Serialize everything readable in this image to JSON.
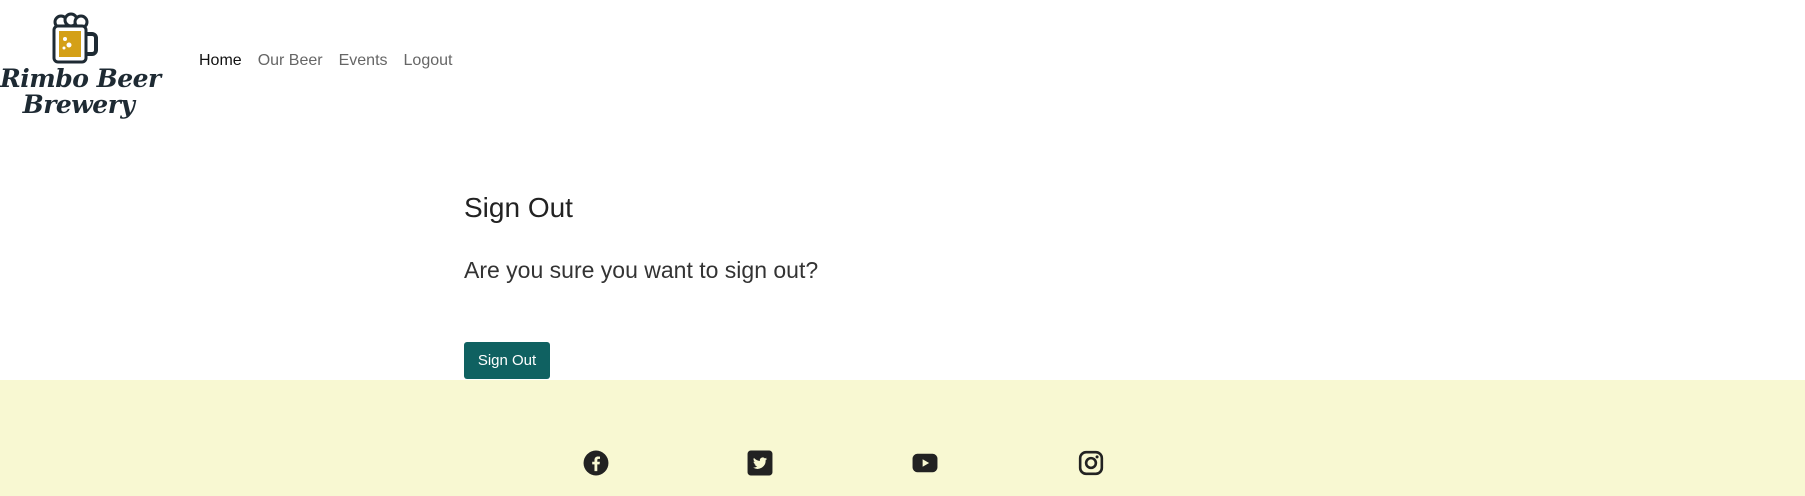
{
  "brand": {
    "line1": "Rimbo Beer",
    "line2": "Brewery",
    "mug_color": "#d4a017",
    "ink_color": "#1e2a33"
  },
  "nav": {
    "items": [
      {
        "label": "Home",
        "active": true
      },
      {
        "label": "Our Beer",
        "active": false
      },
      {
        "label": "Events",
        "active": false
      },
      {
        "label": "Logout",
        "active": false
      }
    ]
  },
  "main": {
    "title": "Sign Out",
    "question": "Are you sure you want to sign out?",
    "button_label": "Sign Out",
    "button_color": "#0f6161"
  },
  "footer": {
    "background": "#f8f8d2",
    "social": [
      "facebook-icon",
      "twitter-icon",
      "youtube-icon",
      "instagram-icon"
    ]
  }
}
